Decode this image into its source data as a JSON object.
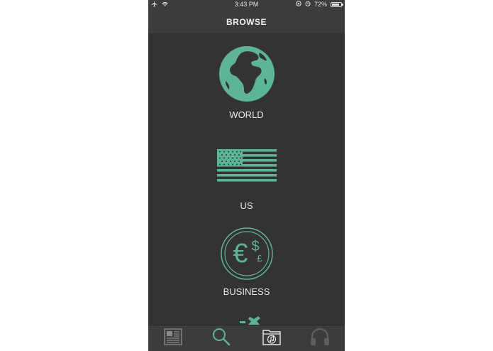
{
  "status_bar": {
    "time": "3:43 PM",
    "battery": "72%",
    "icons": [
      "airplane-icon",
      "wifi-icon",
      "lock-rotation-icon",
      "alarm-icon",
      "battery-icon"
    ]
  },
  "nav": {
    "title": "BROWSE"
  },
  "categories": [
    {
      "label": "WORLD",
      "icon": "globe-icon"
    },
    {
      "label": "US",
      "icon": "us-flag-icon"
    },
    {
      "label": "BUSINESS",
      "icon": "currency-coin-icon"
    }
  ],
  "tab_bar": {
    "tabs": [
      {
        "icon": "newspaper-icon"
      },
      {
        "icon": "search-icon",
        "active": true
      },
      {
        "icon": "music-folder-icon"
      },
      {
        "icon": "headphones-icon"
      }
    ]
  },
  "colors": {
    "accent": "#5bb596",
    "background": "#333333",
    "bar": "#3c3c3c",
    "inactive_icon": "#8a8a8a"
  }
}
